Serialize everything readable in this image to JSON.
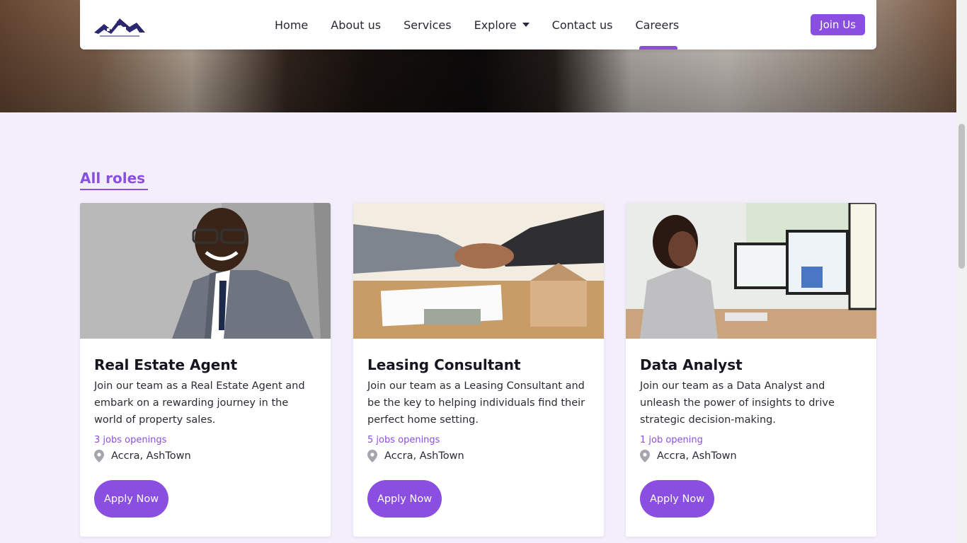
{
  "nav": {
    "logo_alt": "house logo",
    "links": [
      "Home",
      "About us",
      "Services",
      "Explore",
      "Contact us",
      "Careers"
    ],
    "active": "Careers",
    "join_label": "Join Us"
  },
  "section": {
    "title": "All roles"
  },
  "roles": [
    {
      "title": "Real Estate Agent",
      "description": "Join our team as a Real Estate Agent and embark on a rewarding journey in the world of property sales.",
      "openings": "3 jobs openings",
      "location": "Accra, AshTown",
      "apply_label": "Apply Now",
      "image": "smiling-man-in-suit"
    },
    {
      "title": "Leasing Consultant",
      "description": "Join our team as a Leasing Consultant and be the key to helping individuals find their perfect home setting.",
      "openings": "5 jobs openings",
      "location": "Accra, AshTown",
      "apply_label": "Apply Now",
      "image": "handshake-over-desk"
    },
    {
      "title": "Data Analyst",
      "description": "Join our team as a Data Analyst and unleash the power of insights to drive strategic decision-making.",
      "openings": "1 job opening",
      "location": "Accra, AshTown",
      "apply_label": "Apply Now",
      "image": "woman-at-monitors"
    }
  ],
  "colors": {
    "accent": "#8a4fe0",
    "background": "#f2eefc"
  }
}
